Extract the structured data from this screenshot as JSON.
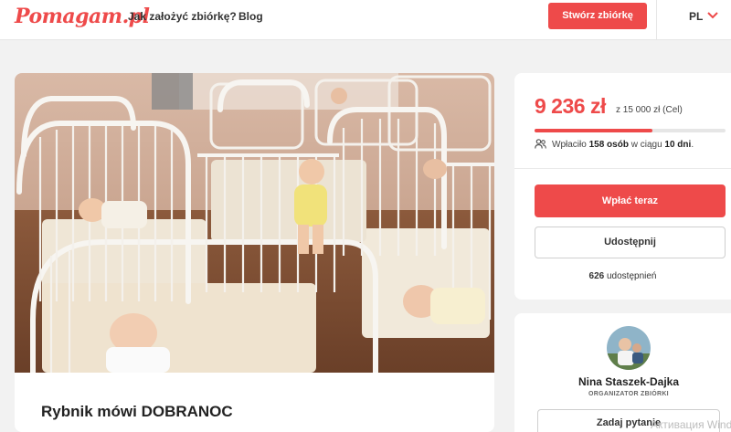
{
  "header": {
    "logo": "Pomagam.pl",
    "nav": [
      "Jak założyć zbiórkę?",
      "Blog"
    ],
    "create_button": "Stwórz zbiórkę",
    "language": "PL"
  },
  "campaign": {
    "title": "Rybnik mówi DOBRANOC",
    "photo_icon": "nursery-cribs-photo"
  },
  "funding": {
    "amount": "9 236 zł",
    "goal": "z 15 000 zł (Cel)",
    "progress": 0.616,
    "donors_prefix": "Wpłaciło",
    "donors_count": "158 osób",
    "donors_middle": "w ciągu",
    "days": "10 dni",
    "donors_suffix": ".",
    "donate_button": "Wpłać teraz",
    "share_button": "Udostępnij",
    "shares_count": "626",
    "shares_label": "udostępnień"
  },
  "organizer": {
    "name": "Nina Staszek-Dajka",
    "role": "ORGANIZATOR ZBIÓRKI",
    "ask_button": "Zadaj pytanie"
  },
  "watermark": "Активация Windo",
  "colors": {
    "accent": "#ee4a4a",
    "background": "#f2f2f2"
  }
}
